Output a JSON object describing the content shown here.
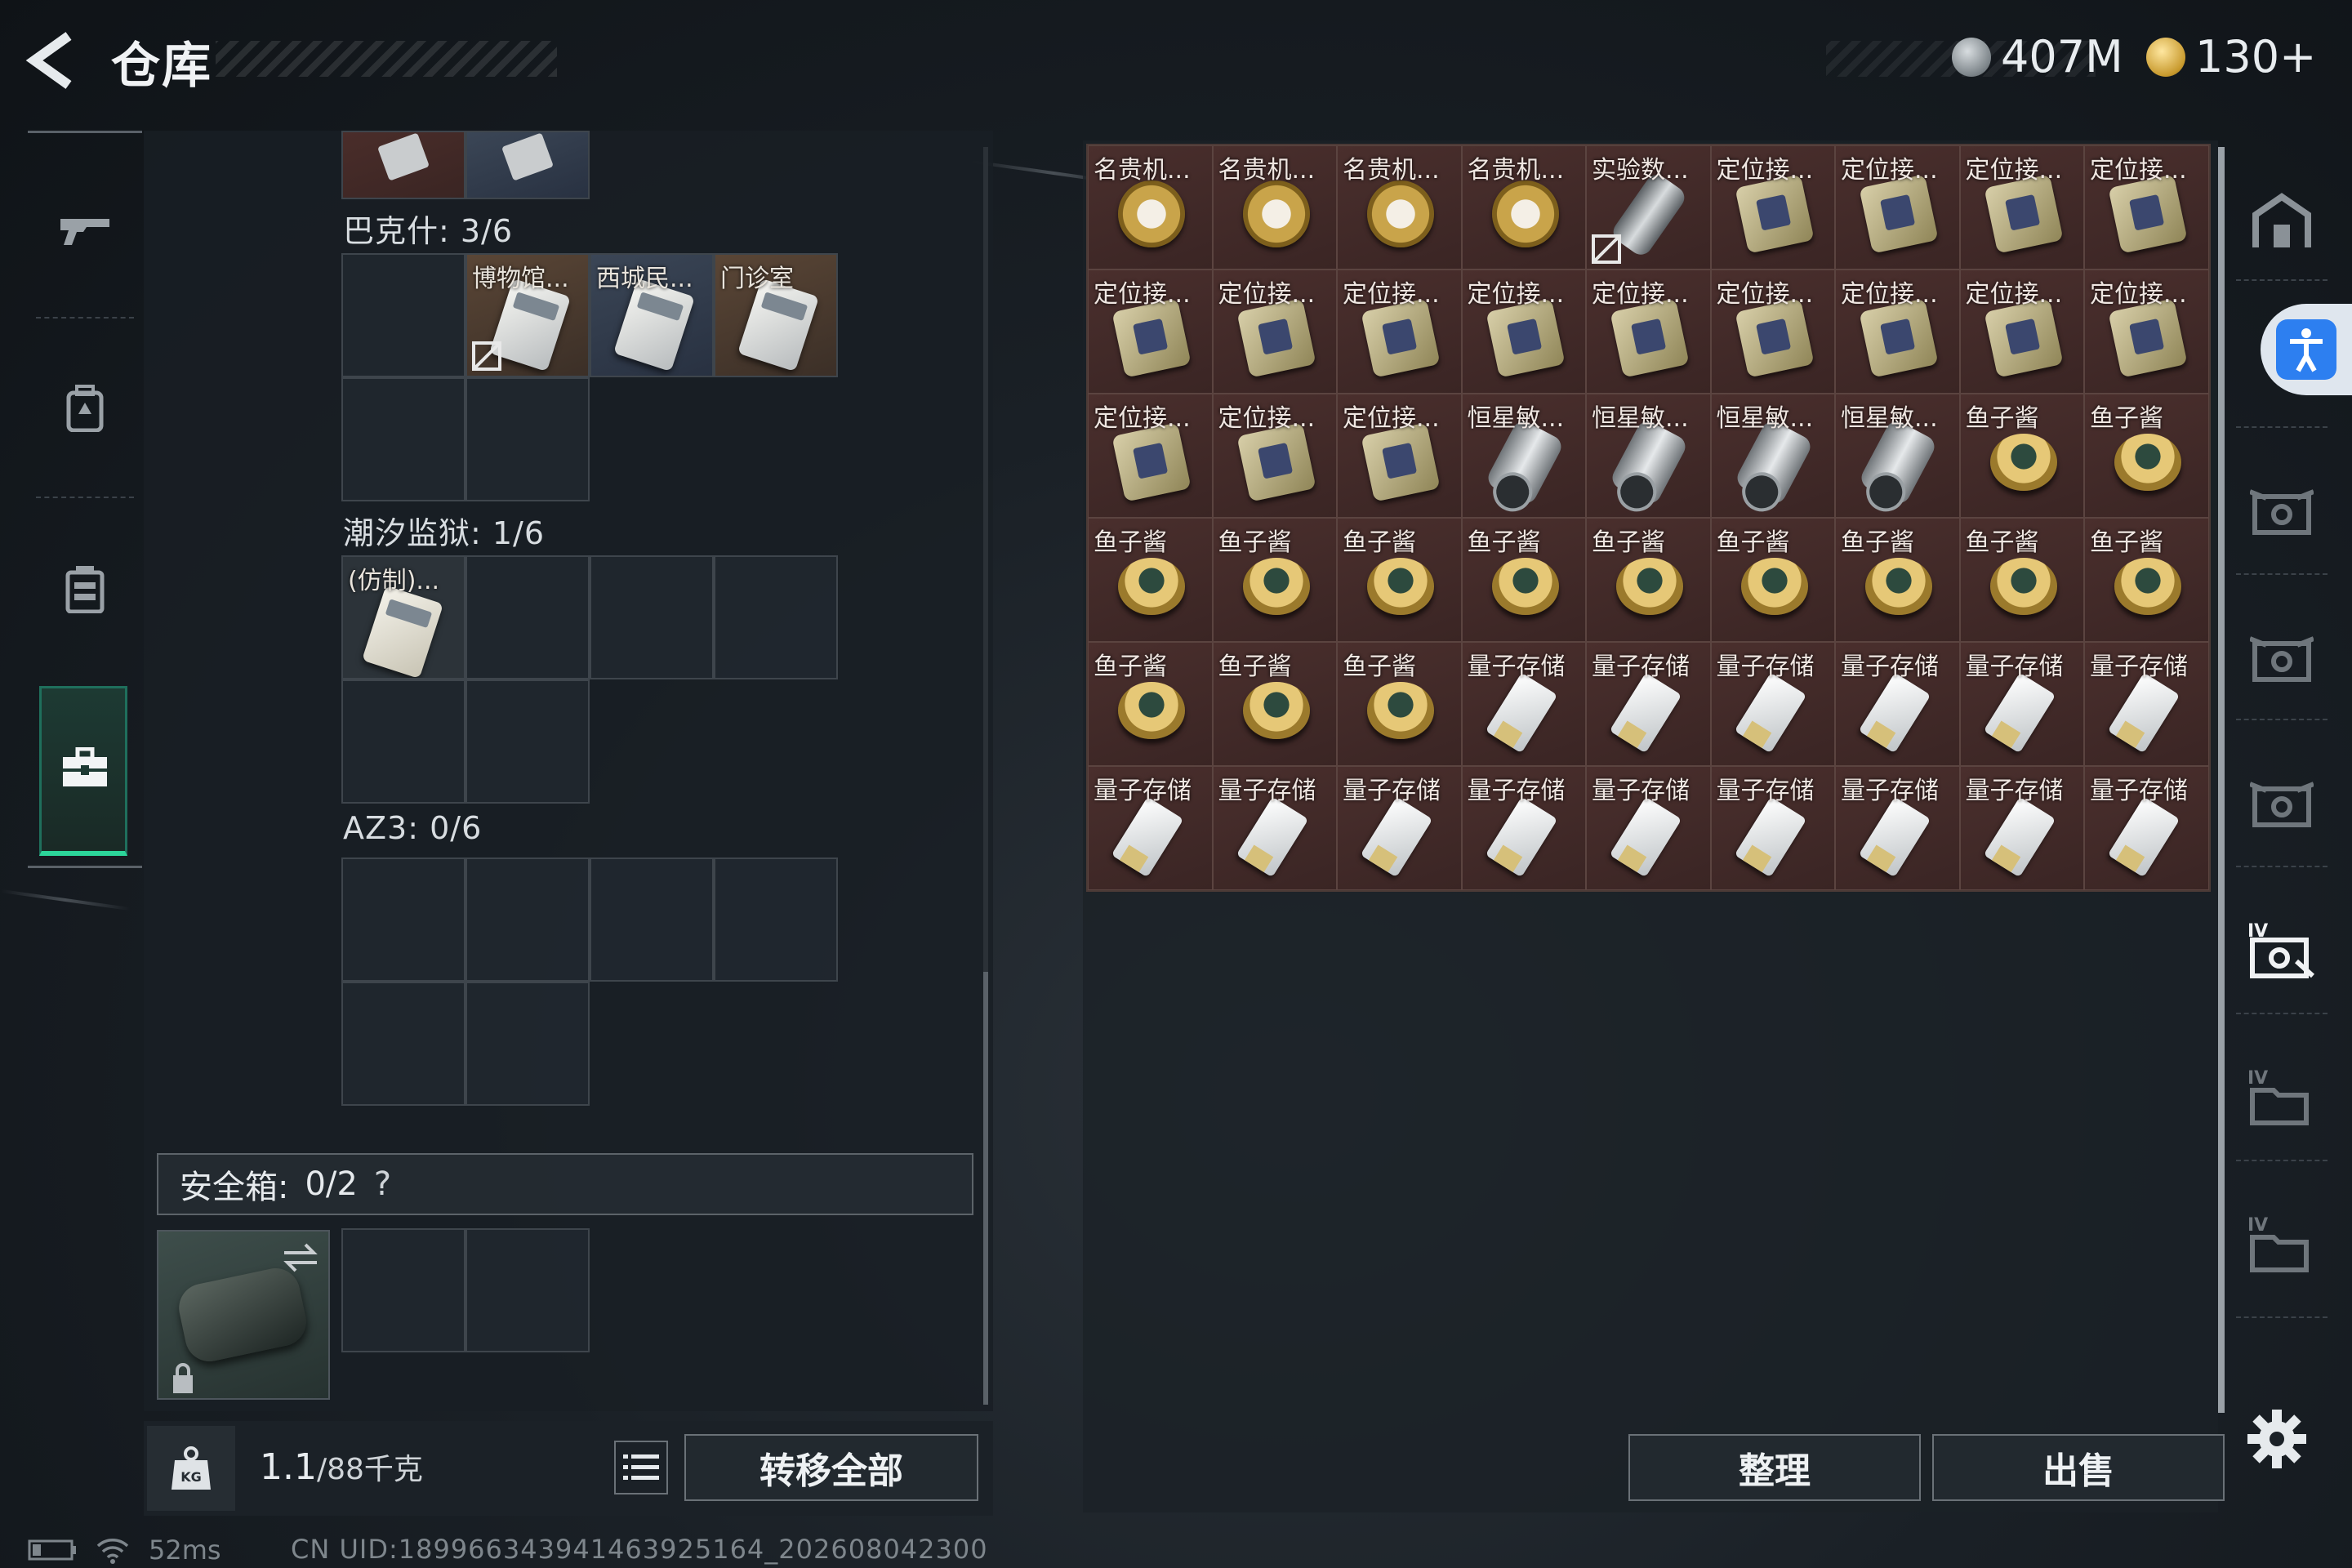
{
  "header": {
    "title": "仓库",
    "currency1": "407M",
    "currency2": "130+"
  },
  "nav": {
    "icons": [
      "gun-icon",
      "backpack-icon",
      "vest-icon",
      "toolbox-icon"
    ],
    "active": 3
  },
  "left": {
    "top_cells": [
      "",
      ""
    ],
    "sections": [
      {
        "label": "巴克什: 3/6",
        "items": [
          {
            "label": "博物馆...",
            "broken": true
          },
          {
            "label": "西城民...",
            "broken": false
          },
          {
            "label": "门诊室",
            "broken": false
          }
        ]
      },
      {
        "label": "潮汐监狱: 1/6",
        "items": [
          {
            "label": "(仿制)...",
            "broken": false
          }
        ]
      },
      {
        "label": "AZ3: 0/6",
        "items": []
      }
    ],
    "safe_box": {
      "label": "安全箱:",
      "count": "0/2",
      "help": "?"
    },
    "weight_current": "1.1",
    "weight_max": "/88千克",
    "transfer_all": "转移全部"
  },
  "right": {
    "items": [
      "名贵机...",
      "名贵机...",
      "名贵机...",
      "名贵机...",
      "实验数...",
      "定位接...",
      "定位接...",
      "定位接...",
      "定位接...",
      "定位接...",
      "定位接...",
      "定位接...",
      "定位接...",
      "定位接...",
      "定位接...",
      "定位接...",
      "定位接...",
      "定位接...",
      "定位接...",
      "定位接...",
      "定位接...",
      "恒星敏...",
      "恒星敏...",
      "恒星敏...",
      "恒星敏...",
      "鱼子酱",
      "鱼子酱",
      "鱼子酱",
      "鱼子酱",
      "鱼子酱",
      "鱼子酱",
      "鱼子酱",
      "鱼子酱",
      "鱼子酱",
      "鱼子酱",
      "鱼子酱",
      "鱼子酱",
      "鱼子酱",
      "鱼子酱",
      "量子存储",
      "量子存储",
      "量子存储",
      "量子存储",
      "量子存储",
      "量子存储",
      "量子存储",
      "量子存储",
      "量子存储",
      "量子存储",
      "量子存储",
      "量子存储",
      "量子存储",
      "量子存储",
      "量子存储"
    ],
    "sort": "整理",
    "sell": "出售",
    "side_labels": [
      "IV",
      "IV",
      "IV"
    ]
  },
  "status": {
    "ping": "52ms",
    "uid": "CN UID:1899663439414639251​64_202608042300"
  }
}
